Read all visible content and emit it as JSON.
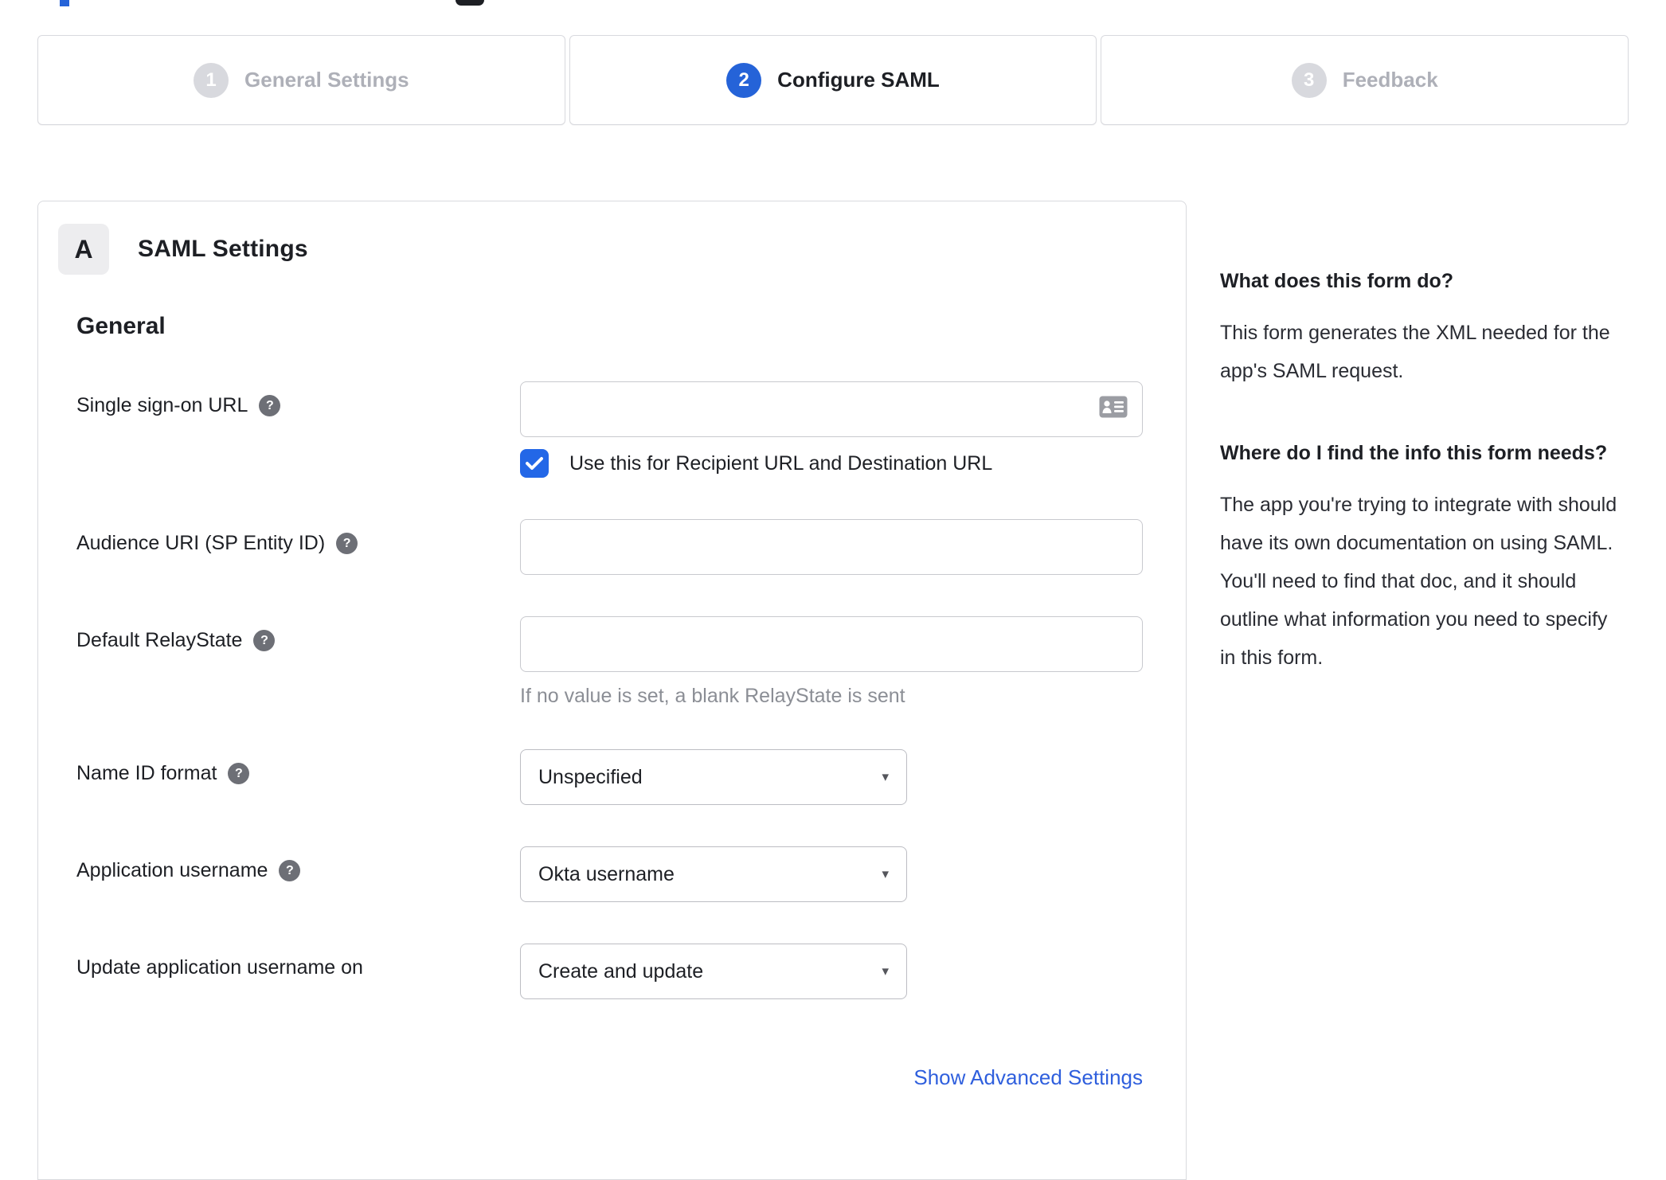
{
  "stepper": {
    "steps": [
      {
        "number": "1",
        "label": "General Settings",
        "state": "inactive"
      },
      {
        "number": "2",
        "label": "Configure SAML",
        "state": "active"
      },
      {
        "number": "3",
        "label": "Feedback",
        "state": "inactive"
      }
    ]
  },
  "panel": {
    "badge": "A",
    "title": "SAML Settings",
    "section_heading": "General",
    "rows": {
      "sso_url": {
        "label": "Single sign-on URL",
        "value": "",
        "checkbox_label": "Use this for Recipient URL and Destination URL",
        "checkbox_checked": true
      },
      "audience_uri": {
        "label": "Audience URI (SP Entity ID)",
        "value": ""
      },
      "relay_state": {
        "label": "Default RelayState",
        "value": "",
        "helper": "If no value is set, a blank RelayState is sent"
      },
      "name_id": {
        "label": "Name ID format",
        "value": "Unspecified"
      },
      "app_username": {
        "label": "Application username",
        "value": "Okta username"
      },
      "update_username": {
        "label": "Update application username on",
        "value": "Create and update"
      }
    },
    "advanced_link": "Show Advanced Settings"
  },
  "help": {
    "sections": [
      {
        "title": "What does this form do?",
        "body": "This form generates the XML needed for the app's SAML request."
      },
      {
        "title": "Where do I find the info this form needs?",
        "body": "The app you're trying to integrate with should have its own documentation on using SAML. You'll need to find that doc, and it should outline what information you need to specify in this form."
      }
    ]
  },
  "icons": {
    "help_glyph": "?",
    "select_arrow": "▾"
  },
  "colors": {
    "step_active_blue": "#2563d8",
    "checkbox_blue": "#2367e7",
    "link_blue": "#2f5fdd",
    "inactive_gray": "#d8d9de",
    "border_gray": "#c8c9ce"
  }
}
